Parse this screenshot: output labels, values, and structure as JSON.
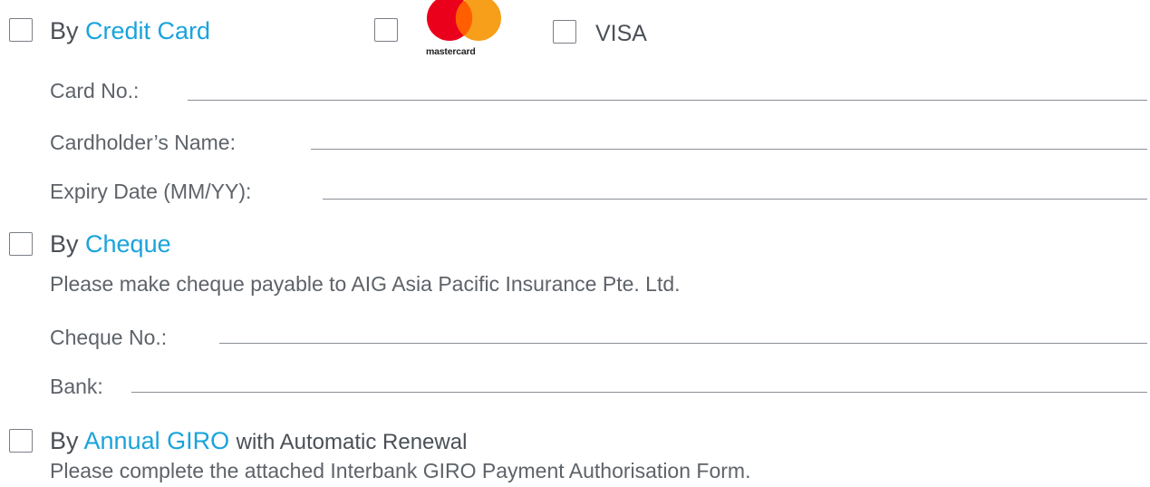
{
  "credit_card": {
    "by": "By",
    "method": "Credit Card",
    "mastercard_wordmark": "mastercard",
    "visa": "VISA",
    "fields": {
      "card_no": "Card No.:",
      "cardholder_name": "Cardholder’s Name:",
      "expiry_date": "Expiry Date (MM/YY):"
    }
  },
  "cheque": {
    "by": "By",
    "method": "Cheque",
    "note": "Please make cheque payable to AIG Asia Pacific Insurance Pte. Ltd.",
    "fields": {
      "cheque_no": "Cheque No.:",
      "bank": "Bank:"
    }
  },
  "giro": {
    "by": "By",
    "method": "Annual GIRO",
    "suffix": "with Automatic Renewal",
    "note": "Please complete the attached Interbank GIRO Payment Authorisation Form."
  },
  "colors": {
    "accent": "#1aa3dc",
    "text": "#4b5056",
    "mastercard_red": "#eb001b",
    "mastercard_orange": "#f79e1b",
    "mastercard_overlap": "#ff5f00"
  }
}
